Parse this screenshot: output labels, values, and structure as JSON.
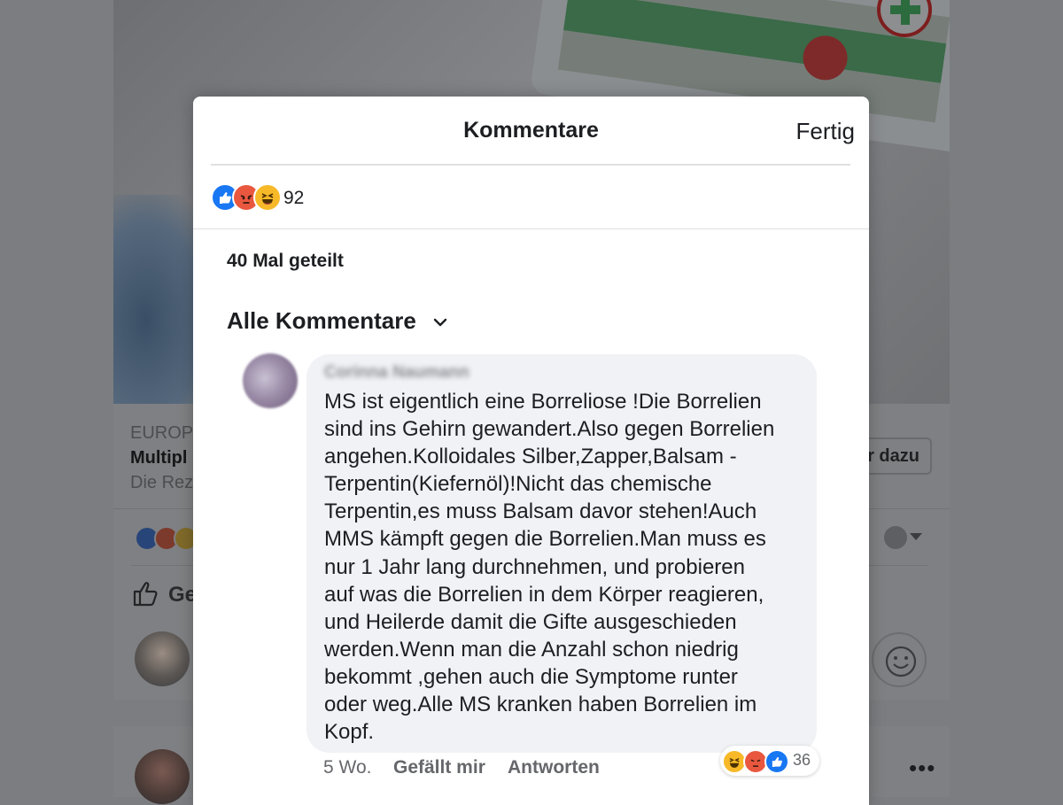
{
  "background": {
    "feed_post": {
      "source_fragment": "EUROP",
      "title_fragment": "Multipl",
      "desc_fragment": "Die Rez",
      "join_button_fragment": "r dazu",
      "like_label_fragment": "Ge"
    }
  },
  "modal": {
    "title": "Kommentare",
    "done_label": "Fertig",
    "reactions": {
      "icons": [
        "like-icon",
        "angry-icon",
        "haha-icon"
      ],
      "count": "92"
    },
    "shares_label": "40 Mal geteilt",
    "comments_filter_label": "Alle Kommentare"
  },
  "comment": {
    "author": "Corinna Naumann",
    "text": "MS ist eigentlich eine Borreliose !Die Borrelien\nsind ins Gehirn gewandert.Also gegen Borrelien\nangehen.Kolloidales Silber,Zapper,Balsam -\nTerpentin(Kiefernöl)!Nicht das chemische\nTerpentin,es muss Balsam davor stehen!Auch\nMMS kämpft gegen die Borrelien.Man muss es\nnur 1 Jahr lang durchnehmen, und probieren\nauf was die Borrelien in dem Körper reagieren,\nund Heilerde damit die Gifte ausgeschieden\nwerden.Wenn man die Anzahl schon niedrig\nbekommt ,gehen auch die Symptome runter\noder weg.Alle MS kranken haben Borrelien im\nKopf.",
    "time": "5 Wo.",
    "like_label": "Gefällt mir",
    "reply_label": "Antworten",
    "reaction_icons": [
      "haha-icon",
      "angry-icon",
      "like-icon"
    ],
    "reaction_count": "36"
  },
  "colors": {
    "like_blue": "#1877f2",
    "angry_red": "#e9573f",
    "haha_yellow": "#f7b928",
    "text_primary": "#1c1e21",
    "text_secondary": "#65676b",
    "bubble_bg": "#f0f2f5"
  }
}
